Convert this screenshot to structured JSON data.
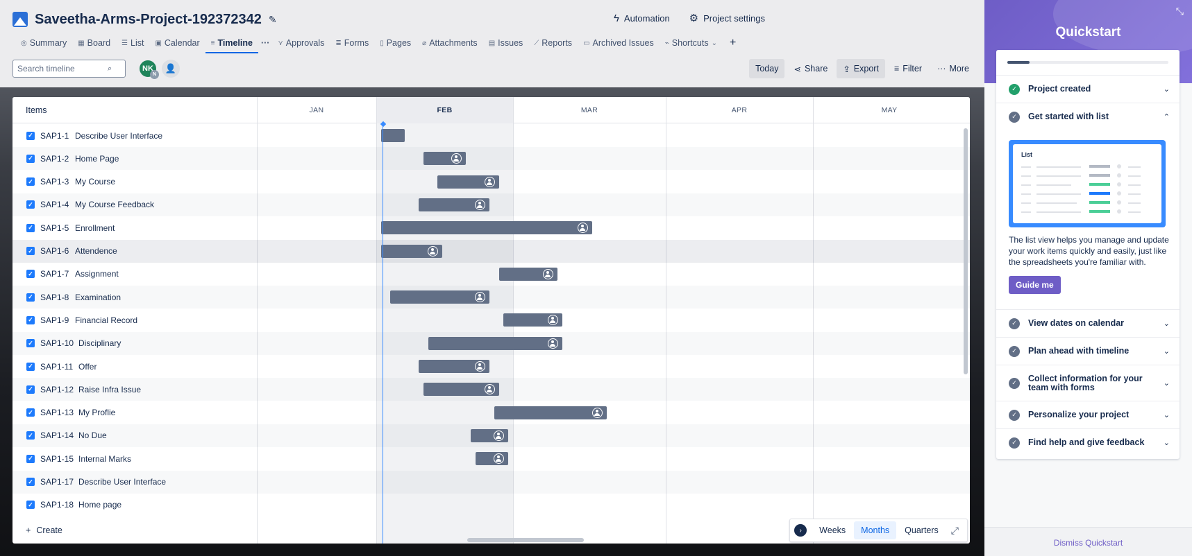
{
  "project": {
    "title": "Saveetha-Arms-Project-192372342"
  },
  "header_actions": {
    "automation": "Automation",
    "settings": "Project settings"
  },
  "tabs": [
    "Summary",
    "Board",
    "List",
    "Calendar",
    "Timeline",
    "Approvals",
    "Forms",
    "Pages",
    "Attachments",
    "Issues",
    "Reports",
    "Archived Issues",
    "Shortcuts"
  ],
  "tab_more": "···",
  "tab_plus": "+",
  "search": {
    "placeholder": "Search timeline"
  },
  "avatar": {
    "initials": "NK",
    "sub": "N"
  },
  "toolbar": {
    "today": "Today",
    "share": "Share",
    "export": "Export",
    "filter": "Filter",
    "more": "More"
  },
  "timeline": {
    "items_header": "Items",
    "months": [
      "JAN",
      "FEB",
      "MAR",
      "APR",
      "MAY"
    ],
    "rows": [
      {
        "key": "SAP1-1",
        "summary": "Describe User Interface",
        "start": "2024-02-02",
        "end": "2024-02-07",
        "assignee": false
      },
      {
        "key": "SAP1-2",
        "summary": "Home Page",
        "start": "2024-02-11",
        "end": "2024-02-20",
        "assignee": true
      },
      {
        "key": "SAP1-3",
        "summary": "My Course",
        "start": "2024-02-14",
        "end": "2024-02-27",
        "assignee": true
      },
      {
        "key": "SAP1-4",
        "summary": "My Course Feedback",
        "start": "2024-02-10",
        "end": "2024-02-25",
        "assignee": true
      },
      {
        "key": "SAP1-5",
        "summary": "Enrollment",
        "start": "2024-02-02",
        "end": "2024-03-17",
        "assignee": true
      },
      {
        "key": "SAP1-6",
        "summary": "Attendence",
        "start": "2024-02-02",
        "end": "2024-02-15",
        "assignee": true
      },
      {
        "key": "SAP1-7",
        "summary": "Assignment",
        "start": "2024-02-27",
        "end": "2024-03-10",
        "assignee": true
      },
      {
        "key": "SAP1-8",
        "summary": "Examination",
        "start": "2024-02-04",
        "end": "2024-02-25",
        "assignee": true
      },
      {
        "key": "SAP1-9",
        "summary": "Financial Record",
        "start": "2024-02-28",
        "end": "2024-03-11",
        "assignee": true
      },
      {
        "key": "SAP1-10",
        "summary": "Disciplinary",
        "start": "2024-02-12",
        "end": "2024-03-11",
        "assignee": true
      },
      {
        "key": "SAP1-11",
        "summary": "Offer",
        "start": "2024-02-10",
        "end": "2024-02-25",
        "assignee": true
      },
      {
        "key": "SAP1-12",
        "summary": "Raise Infra Issue",
        "start": "2024-02-11",
        "end": "2024-02-27",
        "assignee": true
      },
      {
        "key": "SAP1-13",
        "summary": "My Proflie",
        "start": "2024-02-26",
        "end": "2024-03-20",
        "assignee": true
      },
      {
        "key": "SAP1-14",
        "summary": "No Due",
        "start": "2024-02-21",
        "end": "2024-02-29",
        "assignee": true
      },
      {
        "key": "SAP1-15",
        "summary": "Internal Marks",
        "start": "2024-02-22",
        "end": "2024-02-29",
        "assignee": true
      },
      {
        "key": "SAP1-17",
        "summary": "Describe User Interface",
        "start": null,
        "end": null,
        "assignee": false
      },
      {
        "key": "SAP1-18",
        "summary": "Home page",
        "start": null,
        "end": null,
        "assignee": false
      }
    ],
    "create": "Create",
    "zoom": {
      "weeks": "Weeks",
      "months": "Months",
      "quarters": "Quarters",
      "selected": "Months"
    }
  },
  "quickstart": {
    "title": "Quickstart",
    "progress": 0.14,
    "items": [
      {
        "label": "Project created",
        "done": true
      },
      {
        "label": "Get started with list",
        "done": false,
        "expanded": true
      },
      {
        "label": "View dates on calendar",
        "done": false
      },
      {
        "label": "Plan ahead with timeline",
        "done": false
      },
      {
        "label": "Collect information for your team with forms",
        "done": false
      },
      {
        "label": "Personalize your project",
        "done": false
      },
      {
        "label": "Find help and give feedback",
        "done": false
      }
    ],
    "illustration_title": "List",
    "description": "The list view helps you manage and update your work items quickly and easily, just like the spreadsheets you're familiar with.",
    "guide_button": "Guide me",
    "dismiss": "Dismiss Quickstart"
  }
}
